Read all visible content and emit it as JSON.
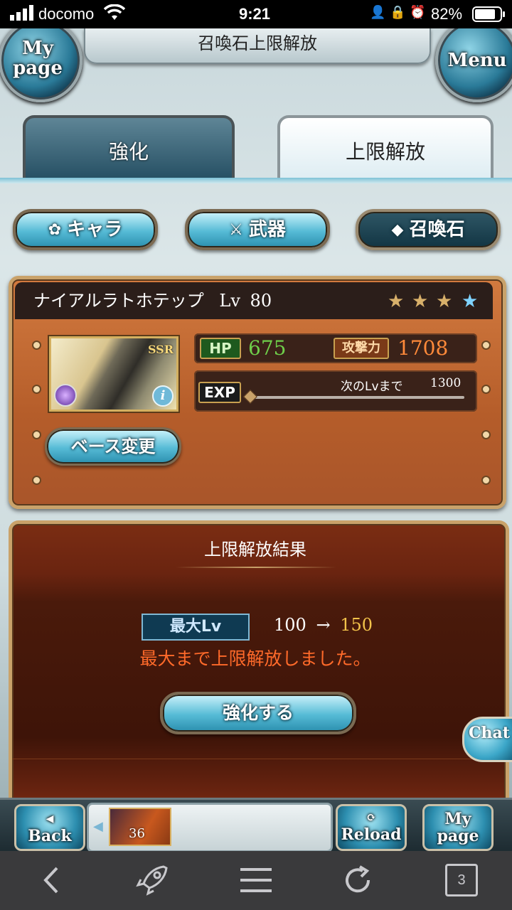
{
  "status_bar": {
    "carrier": "docomo",
    "time": "9:21",
    "battery": "82%"
  },
  "header": {
    "title": "召喚石上限解放",
    "mypage": "My page",
    "menu": "Menu"
  },
  "tabs": [
    {
      "label": "強化",
      "active": false
    },
    {
      "label": "上限解放",
      "active": true
    }
  ],
  "categories": [
    {
      "label": "キャラ",
      "icon": "flower-icon",
      "selected": false
    },
    {
      "label": "武器",
      "icon": "crossed-swords-icon",
      "selected": false
    },
    {
      "label": "召喚石",
      "icon": "crystal-icon",
      "selected": true
    }
  ],
  "summon": {
    "name": "ナイアルラトホテップ",
    "level_label": "Lv",
    "level": "80",
    "stars_filled": 3,
    "stars_total": 4,
    "rarity": "SSR",
    "hp_label": "HP",
    "hp": "675",
    "atk_label": "攻撃力",
    "atk": "1708",
    "exp_label": "EXP",
    "next_level_label": "次のLvまで",
    "next_level_exp": "1300",
    "exp_progress": 0,
    "base_change_button": "ベース変更"
  },
  "result": {
    "title": "上限解放結果",
    "max_lv_label": "最大Lv",
    "from": "100",
    "arrow": "→",
    "to": "150",
    "message": "最大まで上限解放しました。",
    "enhance_button": "強化する"
  },
  "chat_button": "Chat",
  "bottom_bar": {
    "back": "Back",
    "reload": "Reload",
    "mypage": "My page",
    "ap_value": "36"
  },
  "browser_bar": {
    "tabs_count": "3"
  },
  "colors": {
    "hp_value": "#6fcf4a",
    "atk_value": "#ff8a3a",
    "message": "#ff6a2a",
    "to_value": "#f2c24a",
    "accent_blue": "#56bbd6"
  }
}
